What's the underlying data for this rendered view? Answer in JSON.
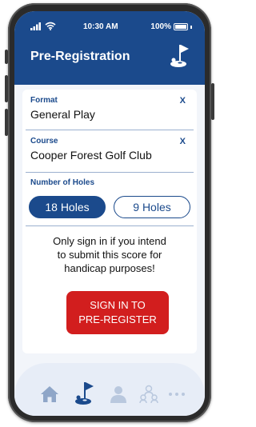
{
  "status_bar": {
    "time": "10:30 AM",
    "battery": "100%"
  },
  "header": {
    "title": "Pre-Registration",
    "icon": "golf-hole-icon"
  },
  "form": {
    "format": {
      "label": "Format",
      "value": "General Play",
      "clear": "X"
    },
    "course": {
      "label": "Course",
      "value": "Cooper Forest Golf Club",
      "clear": "X"
    },
    "holes": {
      "label": "Number of Holes",
      "options": [
        {
          "label": "18 Holes",
          "selected": true
        },
        {
          "label": "9 Holes",
          "selected": false
        }
      ]
    },
    "notice_lines": [
      "Only sign in if you intend",
      "to submit this score for",
      "handicap purposes!"
    ],
    "cta": {
      "line1": "SIGN IN TO",
      "line2": "PRE-REGISTER",
      "color": "#d21e1e"
    }
  },
  "tab_bar": {
    "items": [
      {
        "icon": "home-icon",
        "active": false
      },
      {
        "icon": "golf-hole-icon",
        "active": true
      },
      {
        "icon": "person-icon",
        "active": false
      },
      {
        "icon": "group-icon",
        "active": false
      },
      {
        "icon": "more-icon",
        "active": false
      }
    ]
  },
  "colors": {
    "primary": "#1b4a8c",
    "accent": "#d21e1e",
    "background": "#f2f5fa"
  }
}
